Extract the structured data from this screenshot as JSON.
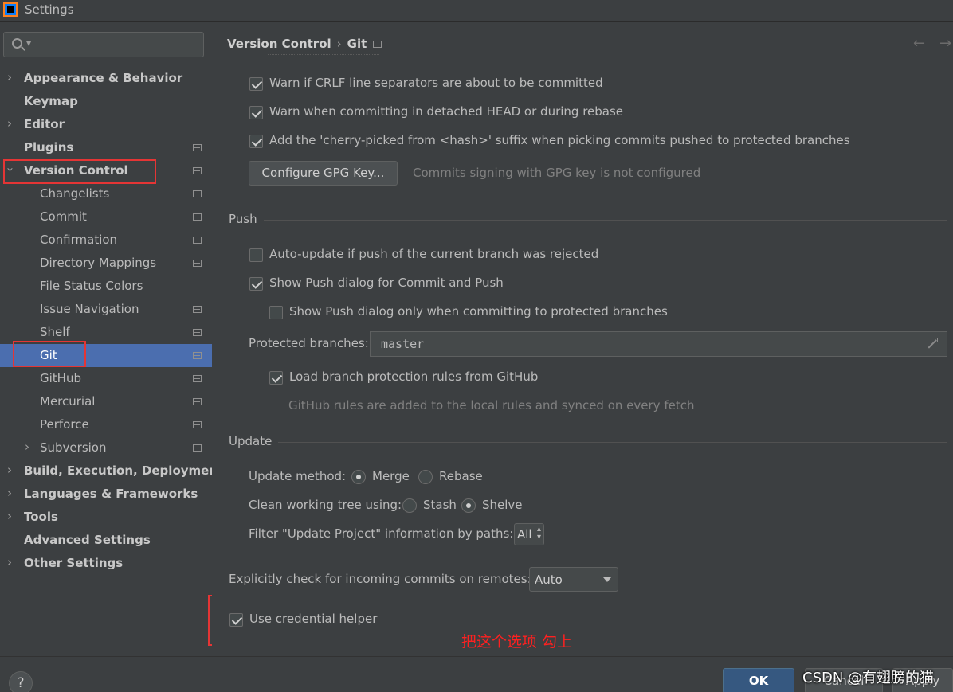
{
  "window": {
    "title": "Settings"
  },
  "search": {
    "placeholder": ""
  },
  "sidebar": {
    "items": [
      {
        "label": "Appearance & Behavior",
        "arrow": "right"
      },
      {
        "label": "Keymap"
      },
      {
        "label": "Editor",
        "arrow": "right"
      },
      {
        "label": "Plugins"
      },
      {
        "label": "Version Control",
        "arrow": "down"
      },
      {
        "label": "Changelists"
      },
      {
        "label": "Commit"
      },
      {
        "label": "Confirmation"
      },
      {
        "label": "Directory Mappings"
      },
      {
        "label": "File Status Colors"
      },
      {
        "label": "Issue Navigation"
      },
      {
        "label": "Shelf"
      },
      {
        "label": "Git",
        "selected": true
      },
      {
        "label": "GitHub"
      },
      {
        "label": "Mercurial"
      },
      {
        "label": "Perforce"
      },
      {
        "label": "Subversion",
        "arrow": "right"
      },
      {
        "label": "Build, Execution, Deployment",
        "arrow": "right"
      },
      {
        "label": "Languages & Frameworks",
        "arrow": "right"
      },
      {
        "label": "Tools",
        "arrow": "right"
      },
      {
        "label": "Advanced Settings"
      },
      {
        "label": "Other Settings",
        "arrow": "right"
      }
    ]
  },
  "breadcrumb": {
    "parent": "Version Control",
    "sep": "›",
    "current": "Git"
  },
  "nav": {
    "back": "←",
    "forward": "→"
  },
  "commit_options": {
    "warn_crlf": {
      "label": "Warn if CRLF line separators are about to be committed",
      "checked": true
    },
    "warn_detached": {
      "label": "Warn when committing in detached HEAD or during rebase",
      "checked": true
    },
    "cherry_picked": {
      "label": "Add the 'cherry-picked from <hash>' suffix when picking commits pushed to protected branches",
      "checked": true
    },
    "gpg_button": "Configure GPG Key...",
    "gpg_hint": "Commits signing with GPG key is not configured"
  },
  "push": {
    "title": "Push",
    "auto_update": {
      "label": "Auto-update if push of the current branch was rejected",
      "checked": false
    },
    "show_dialog": {
      "label": "Show Push dialog for Commit and Push",
      "checked": true
    },
    "show_dialog_protected": {
      "label": "Show Push dialog only when committing to protected branches",
      "checked": false
    },
    "protected_label": "Protected branches:",
    "protected_value": "master",
    "load_rules": {
      "label": "Load branch protection rules from GitHub",
      "checked": true
    },
    "rules_hint": "GitHub rules are added to the local rules and synced on every fetch"
  },
  "update": {
    "title": "Update",
    "method_label": "Update method:",
    "method_merge": "Merge",
    "method_rebase": "Rebase",
    "method_selected": "Merge",
    "clean_label": "Clean working tree using:",
    "clean_stash": "Stash",
    "clean_shelve": "Shelve",
    "clean_selected": "Shelve",
    "filter_label": "Filter \"Update Project\" information by paths:",
    "filter_value": "All"
  },
  "incoming": {
    "label": "Explicitly check for incoming commits on remotes:",
    "value": "Auto"
  },
  "credential": {
    "label": "Use credential helper",
    "checked": true
  },
  "annotation": "把这个选项 勾上",
  "footer": {
    "help": "?",
    "ok": "OK",
    "cancel": "Cancel",
    "apply": "Apply"
  },
  "watermark": "CSDN @有翅膀的猫",
  "colors": {
    "selection": "#4b6eaf",
    "annotation": "#e53535",
    "ok_button": "#365880"
  }
}
